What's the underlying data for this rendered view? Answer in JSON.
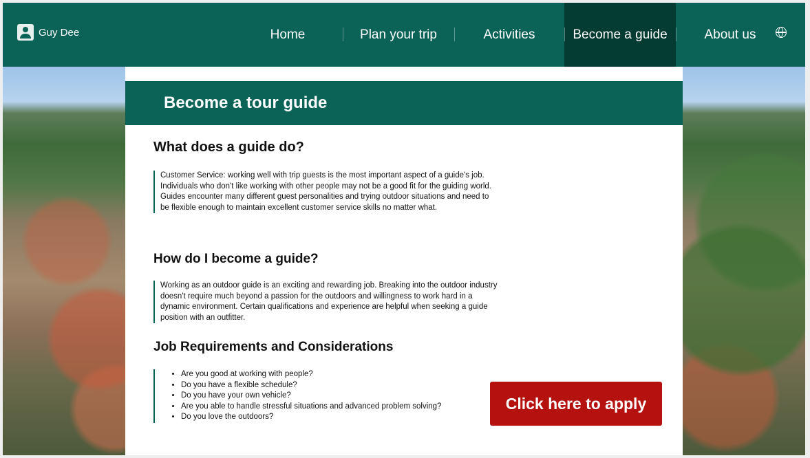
{
  "user": {
    "name": "Guy Dee"
  },
  "nav": {
    "items": [
      {
        "label": "Home"
      },
      {
        "label": "Plan your trip"
      },
      {
        "label": "Activities"
      },
      {
        "label": "Become a guide"
      },
      {
        "label": "About us"
      }
    ],
    "active": "Become a guide"
  },
  "page": {
    "banner_title": "Become a tour guide",
    "sections": [
      {
        "heading": "What does a guide do?",
        "text": "Customer Service: working well with trip guests is the most important aspect of a guide's job. Individuals who don't like working with other people may not be a good fit for the guiding world. Guides encounter many different guest personalities and trying outdoor situations and need to be flexible enough to maintain excellent customer service skills no matter what."
      },
      {
        "heading": "How do I become a guide?",
        "text": "Working as an outdoor guide is an exciting and rewarding job. Breaking into the outdoor industry doesn't require much beyond a passion for the outdoors and willingness to work hard in a dynamic environment. Certain qualifications and experience are helpful when seeking a guide position with an outfitter."
      },
      {
        "heading": "Job Requirements and Considerations",
        "bullets": [
          "Are you good at working with people?",
          "Do you have a flexible schedule?",
          "Do you have your own vehicle?",
          "Are you able to handle stressful situations and advanced problem solving?",
          "Do you love the outdoors?"
        ]
      }
    ],
    "apply_label": "Click here to apply"
  },
  "colors": {
    "brand": "#0b6358",
    "nav_active": "#043b33",
    "apply_button": "#b5120f"
  },
  "icons": [
    "user-avatar-icon",
    "globe-icon"
  ]
}
